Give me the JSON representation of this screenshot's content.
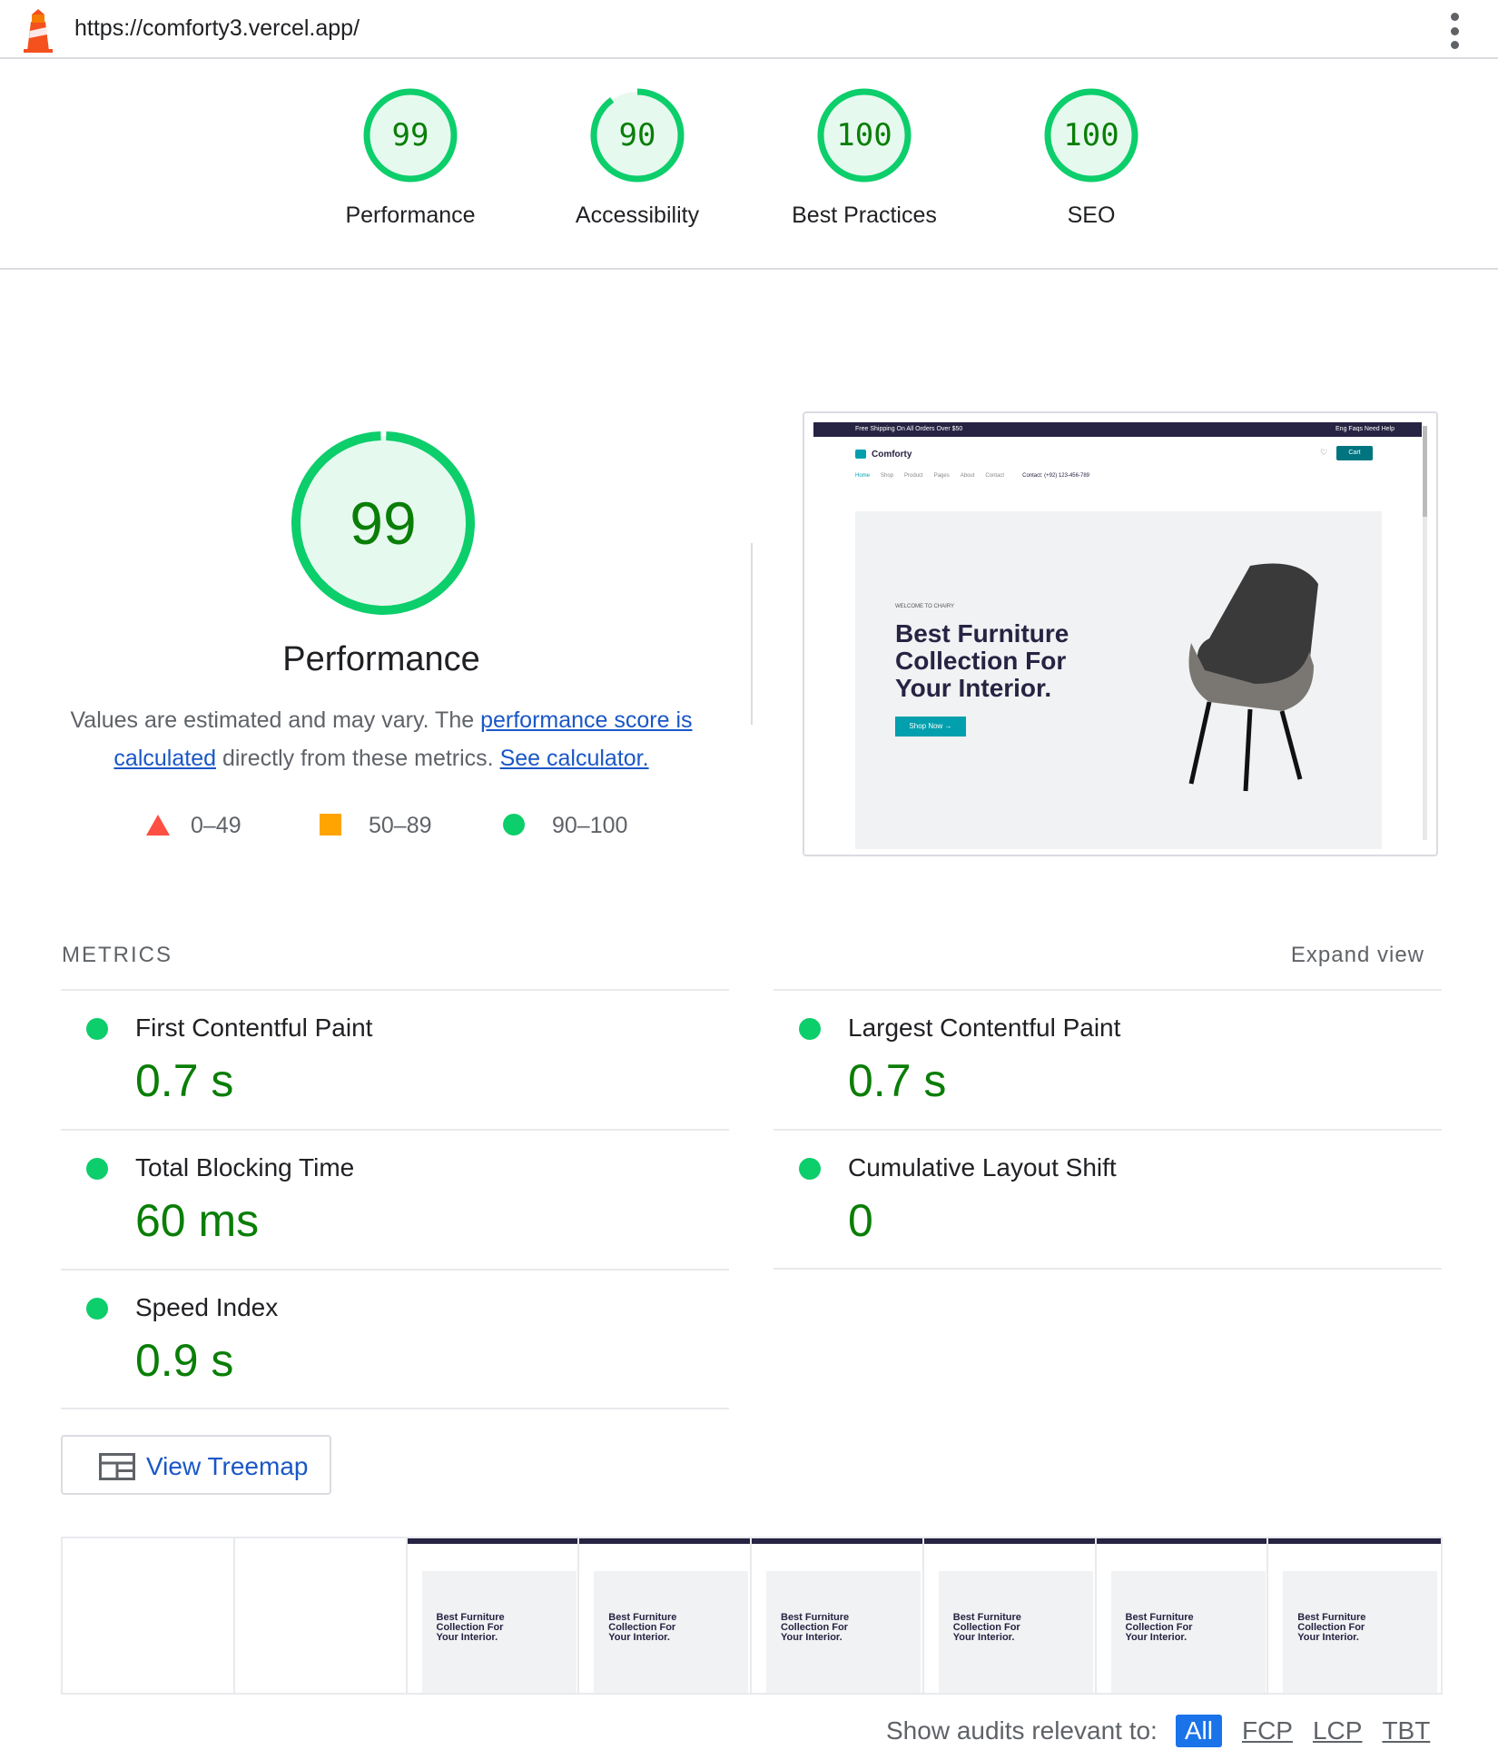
{
  "browser": {
    "url": "https://comforty3.vercel.app/"
  },
  "scores": [
    {
      "label": "Performance",
      "value": 99
    },
    {
      "label": "Accessibility",
      "value": 90
    },
    {
      "label": "Best Practices",
      "value": 100
    },
    {
      "label": "SEO",
      "value": 100
    }
  ],
  "performance": {
    "score": 99,
    "title": "Performance",
    "desc_before": "Values are estimated and may vary. The ",
    "desc_link1": "performance score is calculated",
    "desc_middle": " directly from these metrics. ",
    "desc_link2": "See calculator.",
    "legend": {
      "fail": "0–49",
      "average": "50–89",
      "pass": "90–100"
    }
  },
  "screenshot": {
    "topbar_text": "Free Shipping On All Orders Over $50",
    "topbar_right": "Eng   Faqs   Need Help",
    "brand": "Comforty",
    "cart_label": "Cart",
    "nav": [
      "Home",
      "Shop",
      "Product",
      "Pages",
      "About",
      "Contact"
    ],
    "contact": "Contact: (+92) 123-456-789",
    "hero_kicker": "WELCOME TO CHAIRY",
    "hero_line1": "Best Furniture",
    "hero_line2": "Collection For",
    "hero_line3": "Your Interior.",
    "cta": "Shop Now →"
  },
  "metrics": {
    "heading": "METRICS",
    "expand": "Expand view",
    "items": [
      {
        "name": "First Contentful Paint",
        "value": "0.7 s"
      },
      {
        "name": "Largest Contentful Paint",
        "value": "0.7 s"
      },
      {
        "name": "Total Blocking Time",
        "value": "60 ms"
      },
      {
        "name": "Cumulative Layout Shift",
        "value": "0"
      },
      {
        "name": "Speed Index",
        "value": "0.9 s"
      }
    ]
  },
  "treemap": {
    "label": "View Treemap"
  },
  "filmstrip": {
    "frame_text": "Best Furniture Collection For Your Interior."
  },
  "audits_filter": {
    "label": "Show audits relevant to:",
    "options": [
      "All",
      "FCP",
      "LCP",
      "TBT"
    ]
  },
  "colors": {
    "pass": "#0cce6b",
    "pass_text": "#0a7e07",
    "average": "#ffa400",
    "fail": "#ff4e42",
    "link": "#1a57c6"
  }
}
